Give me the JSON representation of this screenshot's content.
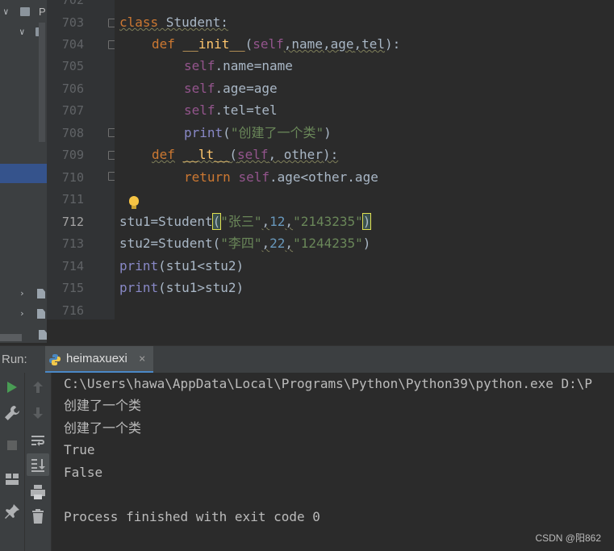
{
  "project_panel": {
    "top_label": "P",
    "items": [
      {
        "type": "folder",
        "expanded": true
      },
      {
        "type": "folder",
        "expanded": true
      },
      {
        "type": "folder",
        "expanded": false
      },
      {
        "type": "file",
        "expanded": false
      },
      {
        "type": "file",
        "expanded": false
      }
    ]
  },
  "editor": {
    "partial_top_line": "702",
    "current_line": "712",
    "lines": [
      {
        "no": "703"
      },
      {
        "no": "704"
      },
      {
        "no": "705"
      },
      {
        "no": "706"
      },
      {
        "no": "707"
      },
      {
        "no": "708"
      },
      {
        "no": "709"
      },
      {
        "no": "710"
      },
      {
        "no": "711"
      },
      {
        "no": "712"
      },
      {
        "no": "713"
      },
      {
        "no": "714"
      },
      {
        "no": "715"
      },
      {
        "no": "716"
      }
    ],
    "code": {
      "l703": {
        "kw": "class",
        "name": " Student:"
      },
      "l704": {
        "kw": "def",
        "fn": "__init__",
        "open": "(",
        "self": "self",
        "p1": ",name",
        "p2": ",age",
        "p3": ",tel",
        "close": "):"
      },
      "l705": {
        "self": "self",
        "rest": ".name=name"
      },
      "l706": {
        "self": "self",
        "rest": ".age=age"
      },
      "l707": {
        "self": "self",
        "rest": ".tel=tel"
      },
      "l708": {
        "bi": "print",
        "open": "(",
        "str": "\"创建了一个类\"",
        "close": ")"
      },
      "l709": {
        "kw": "def",
        "fn": "__lt__",
        "open": "(",
        "self": "self",
        ", other": ", other",
        "close": "):"
      },
      "l710": {
        "kw": "return",
        "self": "self",
        "rest": ".age<other.age"
      },
      "l712": {
        "a": "stu1=Student",
        "open": "(",
        "s1": "\"张三\"",
        "c1": ",",
        "n": "12",
        "c2": ",",
        "s2": "\"2143235\"",
        "close": ")"
      },
      "l713": {
        "a": "stu2=Student(",
        "s1": "\"李四\"",
        "c1": ",",
        "n": "22",
        "c2": ",",
        "s2": "\"1244235\"",
        "close": ")"
      },
      "l714": {
        "bi": "print",
        "rest": "(stu1<stu2)"
      },
      "l715": {
        "bi": "print",
        "rest": "(stu1>stu2)"
      }
    }
  },
  "run_panel": {
    "label": "Run:",
    "tab_name": "heimaxuexi",
    "tab_close": "×"
  },
  "console": {
    "lines": [
      "C:\\Users\\hawa\\AppData\\Local\\Programs\\Python\\Python39\\python.exe D:\\P",
      "创建了一个类",
      "创建了一个类",
      "True",
      "False",
      "",
      "Process finished with exit code 0"
    ]
  },
  "watermark": "CSDN @阳862",
  "colors": {
    "keyword": "#cc7832",
    "self": "#94558d",
    "string": "#6a8759",
    "number": "#6897bb",
    "function": "#ffc66d",
    "builtin": "#8888c6",
    "text": "#a9b7c6",
    "run_green": "#499c54"
  },
  "icons": [
    "run-icon",
    "wrench-icon",
    "stop-icon",
    "layout-icon",
    "pin-icon",
    "up-arrow-icon",
    "down-arrow-icon",
    "soft-wrap-icon",
    "scroll-to-end-icon",
    "print-icon",
    "trash-icon",
    "python-icon",
    "lightbulb-icon"
  ]
}
